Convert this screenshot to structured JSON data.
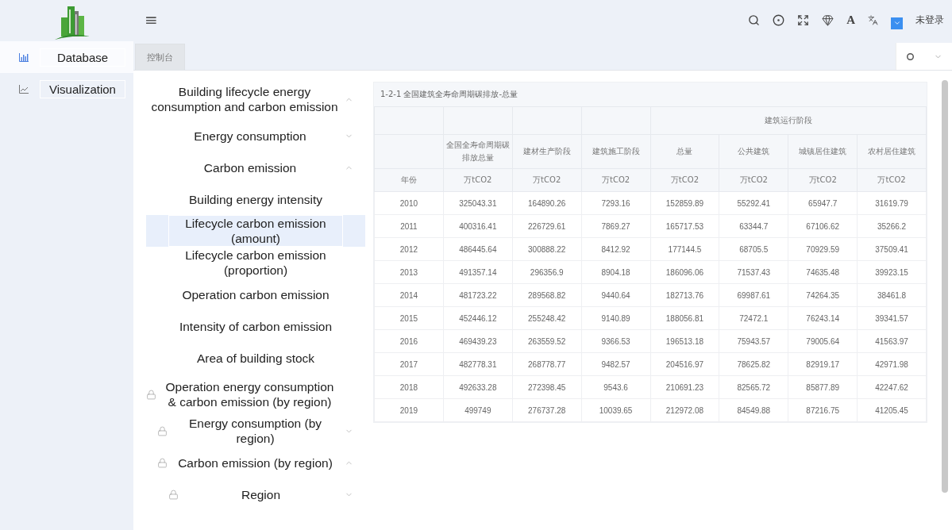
{
  "sidebar": {
    "items": [
      {
        "label": "Database",
        "kind": "bars",
        "selected": true
      },
      {
        "label": "Visualization",
        "kind": "line",
        "selected": false
      }
    ]
  },
  "header": {
    "menu_glyph": "≡",
    "toolbar": [
      {
        "kind": "search"
      },
      {
        "kind": "target"
      },
      {
        "kind": "expand"
      },
      {
        "kind": "gem"
      },
      {
        "kind": "letter",
        "text": "A"
      },
      {
        "kind": "translate"
      },
      {
        "kind": "dropdown"
      }
    ],
    "user": "未登录"
  },
  "tabs": [
    {
      "label": "控制台",
      "selected": true
    }
  ],
  "tree": [
    {
      "label": "Building lifecycle energy consumption and carbon emission",
      "locked": false,
      "selected": false,
      "expanded": true,
      "children": [
        {
          "label": "Energy consumption",
          "locked": false,
          "selected": false,
          "expanded": false
        },
        {
          "label": "Carbon emission",
          "locked": false,
          "selected": false,
          "expanded": true,
          "children": [
            {
              "label": "Building energy intensity",
              "locked": false,
              "selected": false
            },
            {
              "label": "Lifecycle carbon emission (amount)",
              "locked": false,
              "selected": true
            },
            {
              "label": "Lifecycle carbon emission (proportion)",
              "locked": false,
              "selected": false
            },
            {
              "label": "Operation carbon emission",
              "locked": false,
              "selected": false
            },
            {
              "label": "Intensity of carbon emission",
              "locked": false,
              "selected": false
            },
            {
              "label": "Area of building stock",
              "locked": false,
              "selected": false
            }
          ]
        }
      ]
    },
    {
      "label": "Operation energy consumption & carbon emission (by region)",
      "locked": true,
      "selected": false,
      "children": [
        {
          "label": "Energy consumption (by region)",
          "locked": true,
          "selected": false,
          "expanded": false
        },
        {
          "label": "Carbon emission (by region)",
          "locked": true,
          "selected": false,
          "expanded": true,
          "children": [
            {
              "label": "Region",
              "locked": true,
              "selected": false,
              "expanded": false
            }
          ]
        }
      ]
    }
  ],
  "table": {
    "title": "1-2-1 全国建筑全寿命周期碳排放-总量",
    "columns": [
      {
        "unit": "年份"
      },
      {
        "label": "全国全寿命周期碳排放总量",
        "unit": "万tCO2"
      },
      {
        "label": "建材生产阶段",
        "unit": "万tCO2"
      },
      {
        "label": "建筑施工阶段",
        "unit": "万tCO2"
      }
    ],
    "group": {
      "heading": "建筑运行阶段",
      "columns": [
        {
          "label": "总量",
          "unit": "万tCO2"
        },
        {
          "label": "公共建筑",
          "unit": "万tCO2"
        },
        {
          "label": "城镇居住建筑",
          "unit": "万tCO2"
        },
        {
          "label": "农村居住建筑",
          "unit": "万tCO2"
        }
      ]
    },
    "rows": [
      [
        "2010",
        "325043.31",
        "164890.26",
        "7293.16",
        "152859.89",
        "55292.41",
        "65947.7",
        "31619.79"
      ],
      [
        "2011",
        "400316.41",
        "226729.61",
        "7869.27",
        "165717.53",
        "63344.7",
        "67106.62",
        "35266.2"
      ],
      [
        "2012",
        "486445.64",
        "300888.22",
        "8412.92",
        "177144.5",
        "68705.5",
        "70929.59",
        "37509.41"
      ],
      [
        "2013",
        "491357.14",
        "296356.9",
        "8904.18",
        "186096.06",
        "71537.43",
        "74635.48",
        "39923.15"
      ],
      [
        "2014",
        "481723.22",
        "289568.82",
        "9440.64",
        "182713.76",
        "69987.61",
        "74264.35",
        "38461.8"
      ],
      [
        "2015",
        "452446.12",
        "255248.42",
        "9140.89",
        "188056.81",
        "72472.1",
        "76243.14",
        "39341.57"
      ],
      [
        "2016",
        "469439.23",
        "263559.52",
        "9366.53",
        "196513.18",
        "75943.57",
        "79005.64",
        "41563.97"
      ],
      [
        "2017",
        "482778.31",
        "268778.77",
        "9482.57",
        "204516.97",
        "78625.82",
        "82919.17",
        "42971.98"
      ],
      [
        "2018",
        "492633.28",
        "272398.45",
        "9543.6",
        "210691.23",
        "82565.72",
        "85877.89",
        "42247.62"
      ],
      [
        "2019",
        "499749",
        "276737.28",
        "10039.65",
        "212972.08",
        "84549.88",
        "87216.75",
        "41205.45"
      ]
    ]
  }
}
